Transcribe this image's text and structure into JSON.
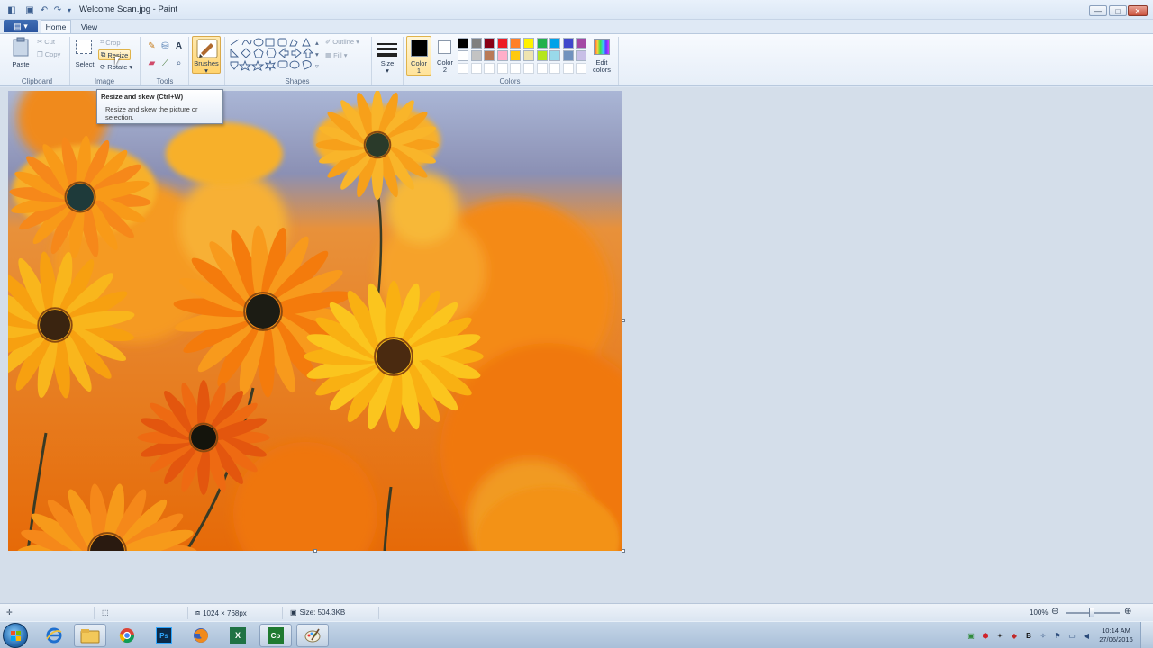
{
  "window": {
    "title": "Welcome Scan.jpg - Paint",
    "controls": {
      "minimize": "—",
      "maximize": "□",
      "close": "✕"
    }
  },
  "tabs": {
    "file": "▤ ▾",
    "home": "Home",
    "view": "View"
  },
  "ribbon": {
    "clipboard": {
      "label": "Clipboard",
      "paste": "Paste",
      "cut": "Cut",
      "copy": "Copy"
    },
    "image": {
      "label": "Image",
      "select": "Select",
      "crop": "Crop",
      "resize": "Resize",
      "rotate": "Rotate"
    },
    "tools": {
      "label": "Tools"
    },
    "brushes": {
      "label": "Brushes"
    },
    "shapes": {
      "label": "Shapes",
      "outline": "Outline",
      "fill": "Fill"
    },
    "size": {
      "label": "Size"
    },
    "colors": {
      "label": "Colors",
      "color1_line1": "Color",
      "color1_line2": "1",
      "color2_line1": "Color",
      "color2_line2": "2",
      "edit_line1": "Edit",
      "edit_line2": "colors",
      "color1_value": "#000000",
      "color2_value": "#ffffff",
      "palette_row1": [
        "#000000",
        "#7f7f7f",
        "#880015",
        "#ed1c24",
        "#ff7f27",
        "#fff200",
        "#22b14c",
        "#00a2e8",
        "#3f48cc",
        "#a349a4"
      ],
      "palette_row2": [
        "#ffffff",
        "#c3c3c3",
        "#b97a57",
        "#ffaec9",
        "#ffc90e",
        "#efe4b0",
        "#b5e61d",
        "#99d9ea",
        "#7092be",
        "#c8bfe7"
      ]
    }
  },
  "tooltip": {
    "title": "Resize and skew (Ctrl+W)",
    "description": "Resize and skew the picture or selection."
  },
  "statusbar": {
    "dimensions": "1024 × 768px",
    "size": "Size: 504.3KB",
    "zoom": "100%"
  },
  "taskbar": {
    "apps": [
      "internet-explorer",
      "file-explorer",
      "chrome",
      "photoshop",
      "firefox",
      "excel",
      "camtasia",
      "paint"
    ],
    "clock_time": "10:14 AM",
    "clock_date": "27/06/2016"
  }
}
